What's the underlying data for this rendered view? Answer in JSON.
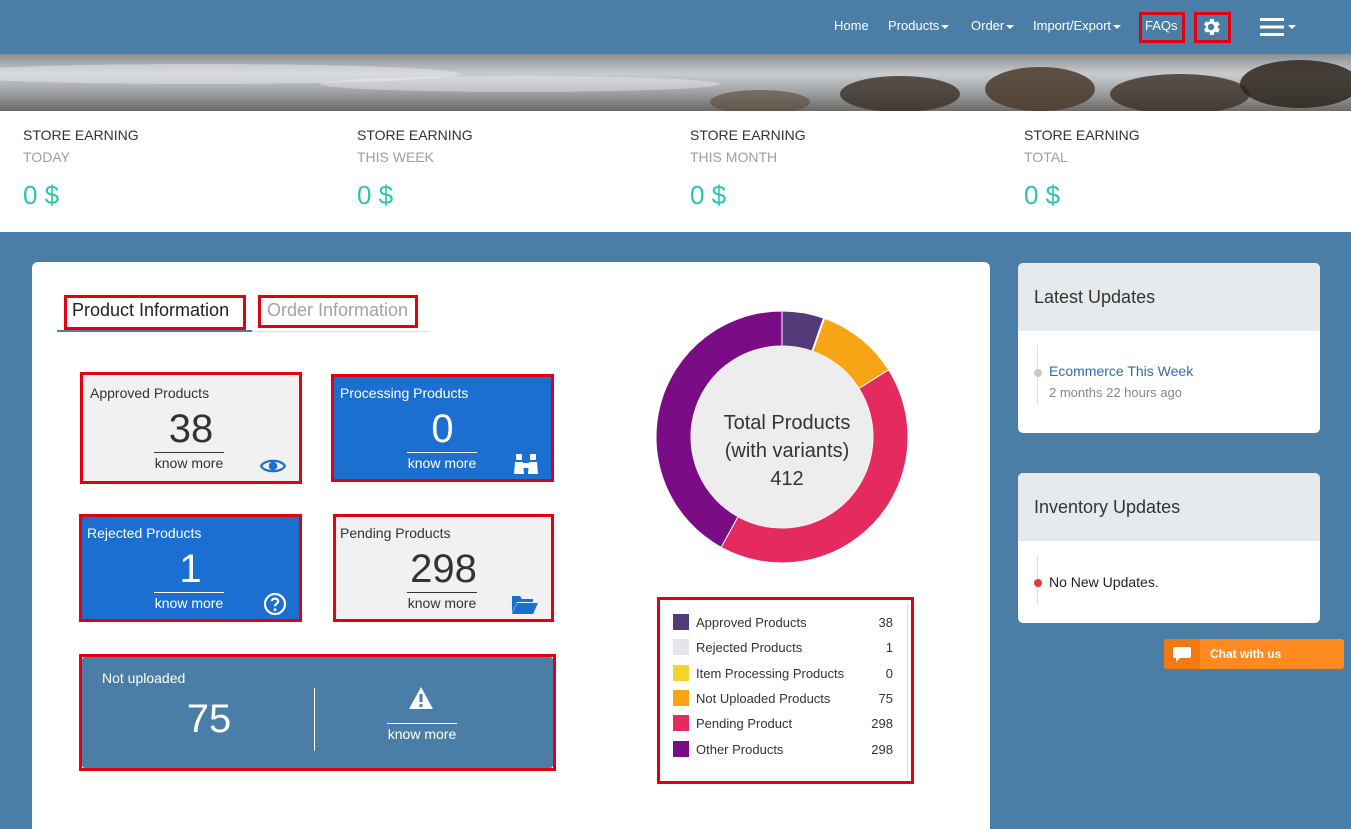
{
  "nav": {
    "home": "Home",
    "products": "Products",
    "order": "Order",
    "import_export": "Import/Export",
    "faqs": "FAQs",
    "settings_icon": "gear-icon",
    "menu_icon": "hamburger-icon"
  },
  "earnings": [
    {
      "label": "STORE EARNING",
      "period": "TODAY",
      "value": "0 $"
    },
    {
      "label": "STORE EARNING",
      "period": "THIS WEEK",
      "value": "0 $"
    },
    {
      "label": "STORE EARNING",
      "period": "THIS MONTH",
      "value": "0 $"
    },
    {
      "label": "STORE EARNING",
      "period": "TOTAL",
      "value": "0 $"
    }
  ],
  "tabs": {
    "product": "Product Information",
    "order": "Order Information"
  },
  "cards": {
    "approved": {
      "title": "Approved Products",
      "value": "38",
      "link": "know more",
      "icon": "eye-icon"
    },
    "processing": {
      "title": "Processing Products",
      "value": "0",
      "link": "know more",
      "icon": "binoculars-icon"
    },
    "rejected": {
      "title": "Rejected Products",
      "value": "1",
      "link": "know more",
      "icon": "question-circle-icon"
    },
    "pending": {
      "title": "Pending Products",
      "value": "298",
      "link": "know more",
      "icon": "folder-open-icon"
    },
    "not_uploaded": {
      "title": "Not uploaded",
      "value": "75",
      "link": "know more",
      "icon": "warning-icon"
    }
  },
  "donut": {
    "line1": "Total Products",
    "line2": "(with variants)",
    "total": "412"
  },
  "legend": [
    {
      "label": "Approved Products",
      "value": "38",
      "color": "#553a7a"
    },
    {
      "label": "Rejected Products",
      "value": "1",
      "color": "#e3e5e8"
    },
    {
      "label": "Item Processing Products",
      "value": "0",
      "color": "#f6d32a"
    },
    {
      "label": "Not Uploaded Products",
      "value": "75",
      "color": "#f8a515"
    },
    {
      "label": "Pending Product",
      "value": "298",
      "color": "#e52a5f"
    },
    {
      "label": "Other Products",
      "value": "298",
      "color": "#7a0d86"
    }
  ],
  "chart_data": {
    "type": "pie",
    "categories": [
      "Approved Products",
      "Rejected Products",
      "Item Processing Products",
      "Not Uploaded Products",
      "Pending Product",
      "Other Products"
    ],
    "values": [
      38,
      1,
      0,
      75,
      298,
      298
    ],
    "colors": [
      "#553a7a",
      "#e3e5e8",
      "#f6d32a",
      "#f8a515",
      "#e52a5f",
      "#7a0d86"
    ],
    "donut": true,
    "legend": "bottom"
  },
  "latest_updates": {
    "title": "Latest Updates",
    "item_title": "Ecommerce This Week",
    "item_time": "2 months 22 hours ago"
  },
  "inventory_updates": {
    "title": "Inventory Updates",
    "message": "No New Updates."
  },
  "chat": {
    "label": "Chat with us",
    "icon": "chat-bubble-icon"
  }
}
